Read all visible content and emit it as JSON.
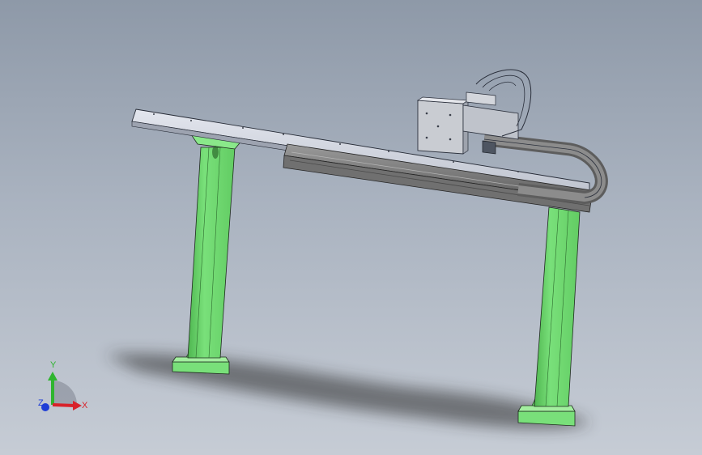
{
  "viewport": {
    "background_top": "#8e99a8",
    "background_bottom": "#c6ccd5"
  },
  "colors": {
    "leg_green": "#79e07a",
    "leg_green_dark": "#4fb650",
    "beam_top": "#d9dde6",
    "beam_side": "#aab0bd",
    "rail_dark": "#6d6d6d",
    "rail_mid": "#8a8a8a",
    "carriage": "#c9ccd2",
    "chain_outline": "#2a2f3b",
    "shadow": "#2c2c2c"
  },
  "triad": {
    "x_label": "X",
    "y_label": "Y",
    "z_label": "Z",
    "x_color": "#d8222a",
    "y_color": "#2fb52f",
    "z_color": "#1f3ed6"
  },
  "icons": {
    "triad": "coordinate-triad-icon"
  }
}
